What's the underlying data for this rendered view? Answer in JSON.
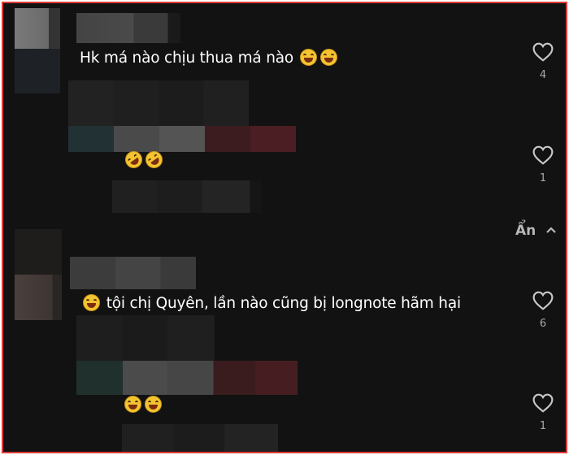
{
  "comments": [
    {
      "text": "Hk má nào chịu thua má nào",
      "emoji": [
        "grinning-squinting-face",
        "grinning-squinting-face"
      ],
      "likes": "4"
    },
    {
      "text": "",
      "emoji": [
        "rolling-on-floor-laughing-face",
        "rolling-on-floor-laughing-face"
      ],
      "likes": "1"
    },
    {
      "text": "tội chị Quyên, lần nào cũng bị longnote hãm hại",
      "emoji": [
        "grinning-squinting-face"
      ],
      "likes": "6"
    },
    {
      "text": "",
      "emoji": [
        "grinning-squinting-face",
        "grinning-squinting-face"
      ],
      "likes": "1"
    }
  ],
  "hide_replies_label": "Ẩn",
  "colors": {
    "background": "#121212",
    "text": "#ffffff",
    "muted": "#a8a8a8",
    "frame_border": "#e03a3a"
  }
}
